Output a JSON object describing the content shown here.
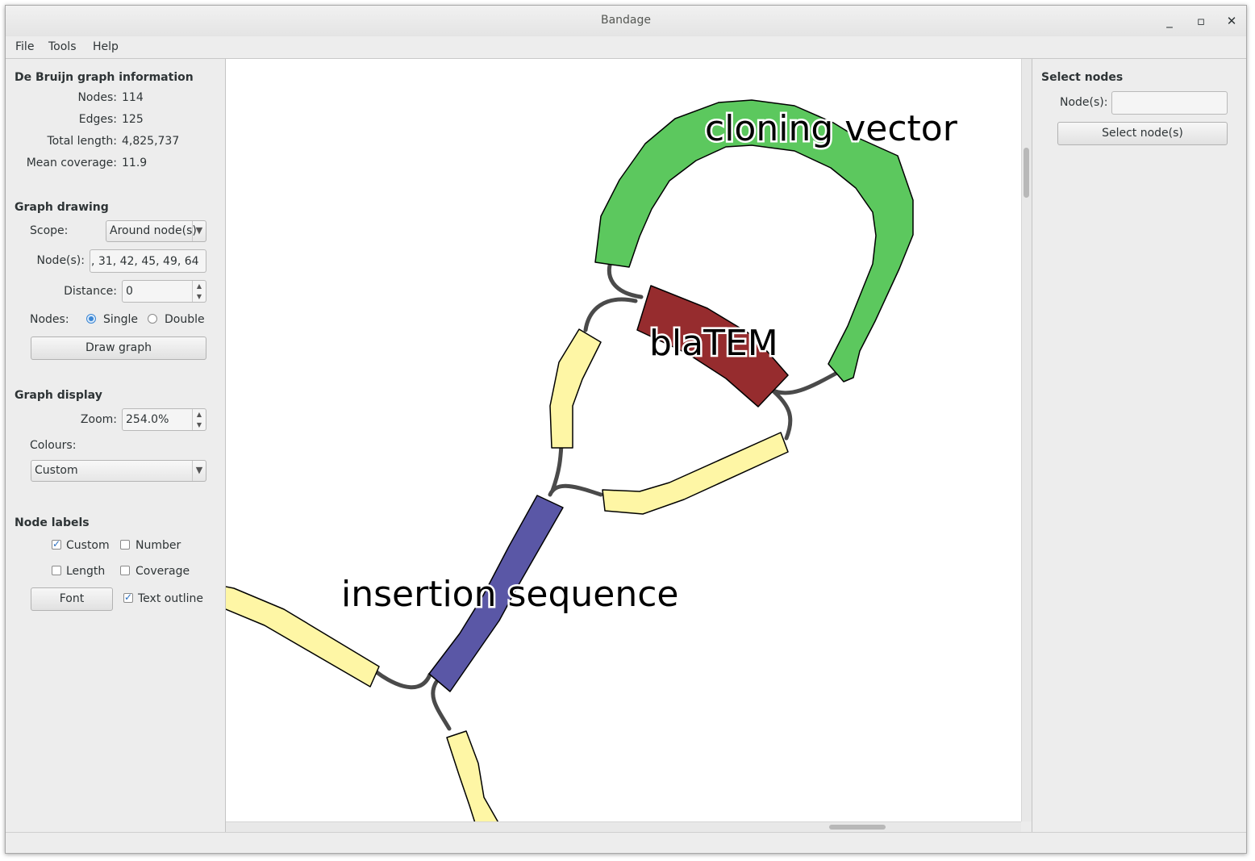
{
  "window": {
    "title": "Bandage",
    "minimize_glyph": "_",
    "maximize_glyph": "▫",
    "close_glyph": "✕"
  },
  "menu": [
    "File",
    "Tools",
    "Help"
  ],
  "left_panel": {
    "graph_info": {
      "title": "De Bruijn graph information",
      "nodes_label": "Nodes:",
      "nodes_value": "114",
      "edges_label": "Edges:",
      "edges_value": "125",
      "total_length_label": "Total length:",
      "total_length_value": "4,825,737",
      "mean_coverage_label": "Mean coverage:",
      "mean_coverage_value": "11.9"
    },
    "graph_drawing": {
      "title": "Graph drawing",
      "scope_label": "Scope:",
      "scope_value": "Around node(s)",
      "nodes_label": "Node(s):",
      "nodes_value": ", 31, 42, 45, 49, 64",
      "distance_label": "Distance:",
      "distance_value": "0",
      "node_style_label": "Nodes:",
      "single_label": "Single",
      "double_label": "Double",
      "single_selected": true,
      "draw_button": "Draw graph"
    },
    "graph_display": {
      "title": "Graph display",
      "zoom_label": "Zoom:",
      "zoom_value": "254.0%",
      "colours_label": "Colours:",
      "colours_value": "Custom"
    },
    "node_labels": {
      "title": "Node labels",
      "custom_label": "Custom",
      "custom_checked": true,
      "number_label": "Number",
      "number_checked": false,
      "length_label": "Length",
      "length_checked": false,
      "coverage_label": "Coverage",
      "coverage_checked": false,
      "font_button": "Font",
      "text_outline_label": "Text outline",
      "text_outline_checked": true
    }
  },
  "right_panel": {
    "title": "Select nodes",
    "nodes_label": "Node(s):",
    "nodes_value": "",
    "select_button": "Select node(s)"
  },
  "graph": {
    "labels": {
      "cloning_vector": "cloning vector",
      "blatem": "blaTEM",
      "insertion_sequence": "insertion sequence"
    },
    "colors": {
      "green_node": "#5cc85e",
      "red_node": "#962c2e",
      "blue_node": "#5a57a6",
      "yellow_node": "#fef6a5",
      "edge": "#4a4a4a"
    }
  }
}
